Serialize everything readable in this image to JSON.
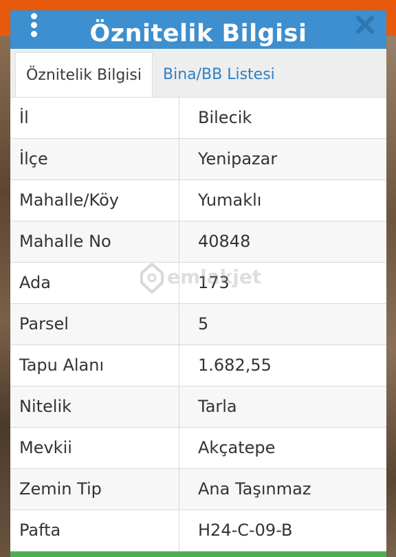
{
  "dialog": {
    "title": "Öznitelik Bilgisi"
  },
  "tabs": [
    {
      "label": "Öznitelik Bilgisi",
      "active": true
    },
    {
      "label": "Bina/BB Listesi",
      "active": false
    }
  ],
  "rows": [
    {
      "label": "İl",
      "value": "Bilecik"
    },
    {
      "label": "İlçe",
      "value": "Yenipazar"
    },
    {
      "label": "Mahalle/Köy",
      "value": "Yumaklı"
    },
    {
      "label": "Mahalle No",
      "value": "40848"
    },
    {
      "label": "Ada",
      "value": "173"
    },
    {
      "label": "Parsel",
      "value": "5"
    },
    {
      "label": "Tapu Alanı",
      "value": "1.682,55"
    },
    {
      "label": "Nitelik",
      "value": "Tarla"
    },
    {
      "label": "Mevkii",
      "value": "Akçatepe"
    },
    {
      "label": "Zemin Tip",
      "value": "Ana Taşınmaz"
    },
    {
      "label": "Pafta",
      "value": "H24-C-09-B"
    }
  ],
  "watermark": {
    "text": "emlakjet"
  },
  "colors": {
    "header": "#3d8fcf",
    "tab_active_text": "#3a3a3a",
    "tab_link": "#2f7fbf",
    "accent_orange": "#e8590c",
    "footer_green": "#4caf50"
  },
  "icons": {
    "menu": "more-vertical-icon",
    "close": "close-icon",
    "watermark_logo": "home-pin-icon"
  }
}
